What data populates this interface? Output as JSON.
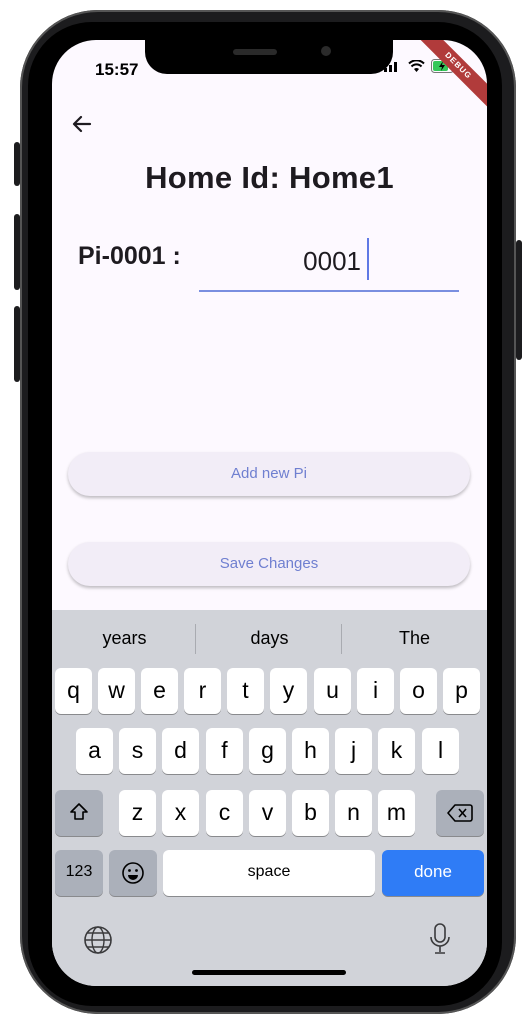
{
  "status_bar": {
    "time": "15:57",
    "debug_label": "DEBUG"
  },
  "page": {
    "title": "Home Id:  Home1",
    "pi_label": "Pi-0001 :",
    "pi_value": "0001",
    "add_button_label": "Add new Pi",
    "save_button_label": "Save Changes"
  },
  "keyboard": {
    "suggestions": [
      "years",
      "days",
      "The"
    ],
    "row1": [
      "q",
      "w",
      "e",
      "r",
      "t",
      "y",
      "u",
      "i",
      "o",
      "p"
    ],
    "row2": [
      "a",
      "s",
      "d",
      "f",
      "g",
      "h",
      "j",
      "k",
      "l"
    ],
    "row3": [
      "z",
      "x",
      "c",
      "v",
      "b",
      "n",
      "m"
    ],
    "numbers_key": "123",
    "space_key": "space",
    "done_key": "done"
  },
  "colors": {
    "accent": "#6f7fd0",
    "done_key": "#2f7cf6",
    "debug_banner": "#b13b3b"
  }
}
